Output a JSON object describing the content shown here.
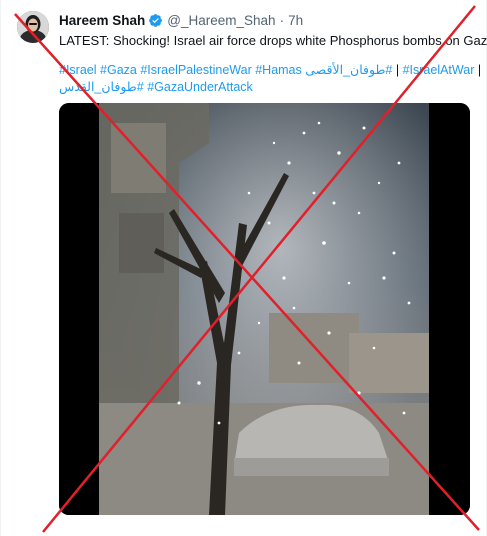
{
  "tweet": {
    "author_name": "Hareem Shah",
    "handle": "@_Hareem_Shah",
    "separator": "·",
    "time": "7h",
    "text": "LATEST: Shocking! Israel air force drops white Phosphorus bombs on Gaza",
    "hashtags_row1": [
      {
        "label": "#Israel"
      },
      {
        "label": "#Gaza"
      },
      {
        "label": "#IsraelPalestineWar"
      },
      {
        "label": "#Hamas"
      },
      {
        "label": "#طوفان_الأقصى"
      }
    ],
    "hashtags_row1_tail": [
      {
        "label": "#IsraelAtWar"
      }
    ],
    "pipe": "|",
    "hashtags_row2": [
      {
        "label": "#طوفان_القدس"
      },
      {
        "label": "#GazaUnderAttack"
      }
    ]
  },
  "icons": {
    "verified": "verified-badge-icon",
    "avatar": "avatar"
  },
  "colors": {
    "link": "#1d9bf0",
    "text": "#0f1419",
    "muted": "#536471",
    "cross": "#e0202a"
  }
}
